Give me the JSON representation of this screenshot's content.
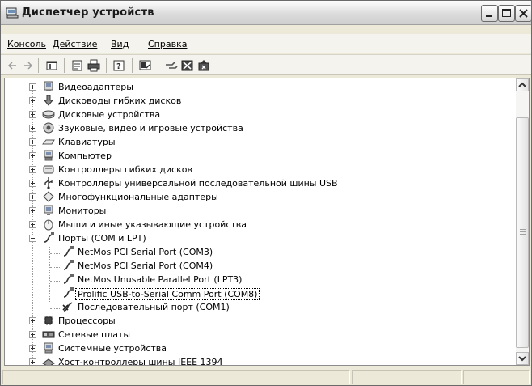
{
  "window": {
    "title": "Диспетчер устройств"
  },
  "menu": [
    "Консоль",
    "Действие",
    "Вид",
    "Справка"
  ],
  "toolbar_icons": [
    "back-icon",
    "forward-icon",
    "console-tree-icon",
    "properties-icon",
    "print-icon",
    "help-icon",
    "scan-hardware-icon",
    "update-driver-icon",
    "disable-icon",
    "uninstall-icon"
  ],
  "tree": {
    "categories_top": [
      "Видеоадаптеры",
      "Дисководы гибких дисков",
      "Дисковые устройства",
      "Звуковые, видео и игровые устройства",
      "Клавиатуры",
      "Компьютер",
      "Контроллеры гибких дисков",
      "Контроллеры универсальной последовательной шины USB",
      "Многофункциональные адаптеры",
      "Мониторы",
      "Мыши и иные указывающие устройства"
    ],
    "ports": {
      "label": "Порты (COM и LPT)",
      "children": [
        "NetMos PCI Serial Port (COM3)",
        "NetMos PCI Serial Port (COM4)",
        "NetMos Unusable Parallel Port (LPT3)",
        "Prolific USB-to-Serial Comm Port (COM8)",
        "Последовательный порт (COM1)"
      ],
      "selected_index": 3
    },
    "categories_bottom": [
      "Процессоры",
      "Сетевые платы",
      "Системные устройства",
      "Хост-контроллеры шины IEEE 1394"
    ]
  }
}
